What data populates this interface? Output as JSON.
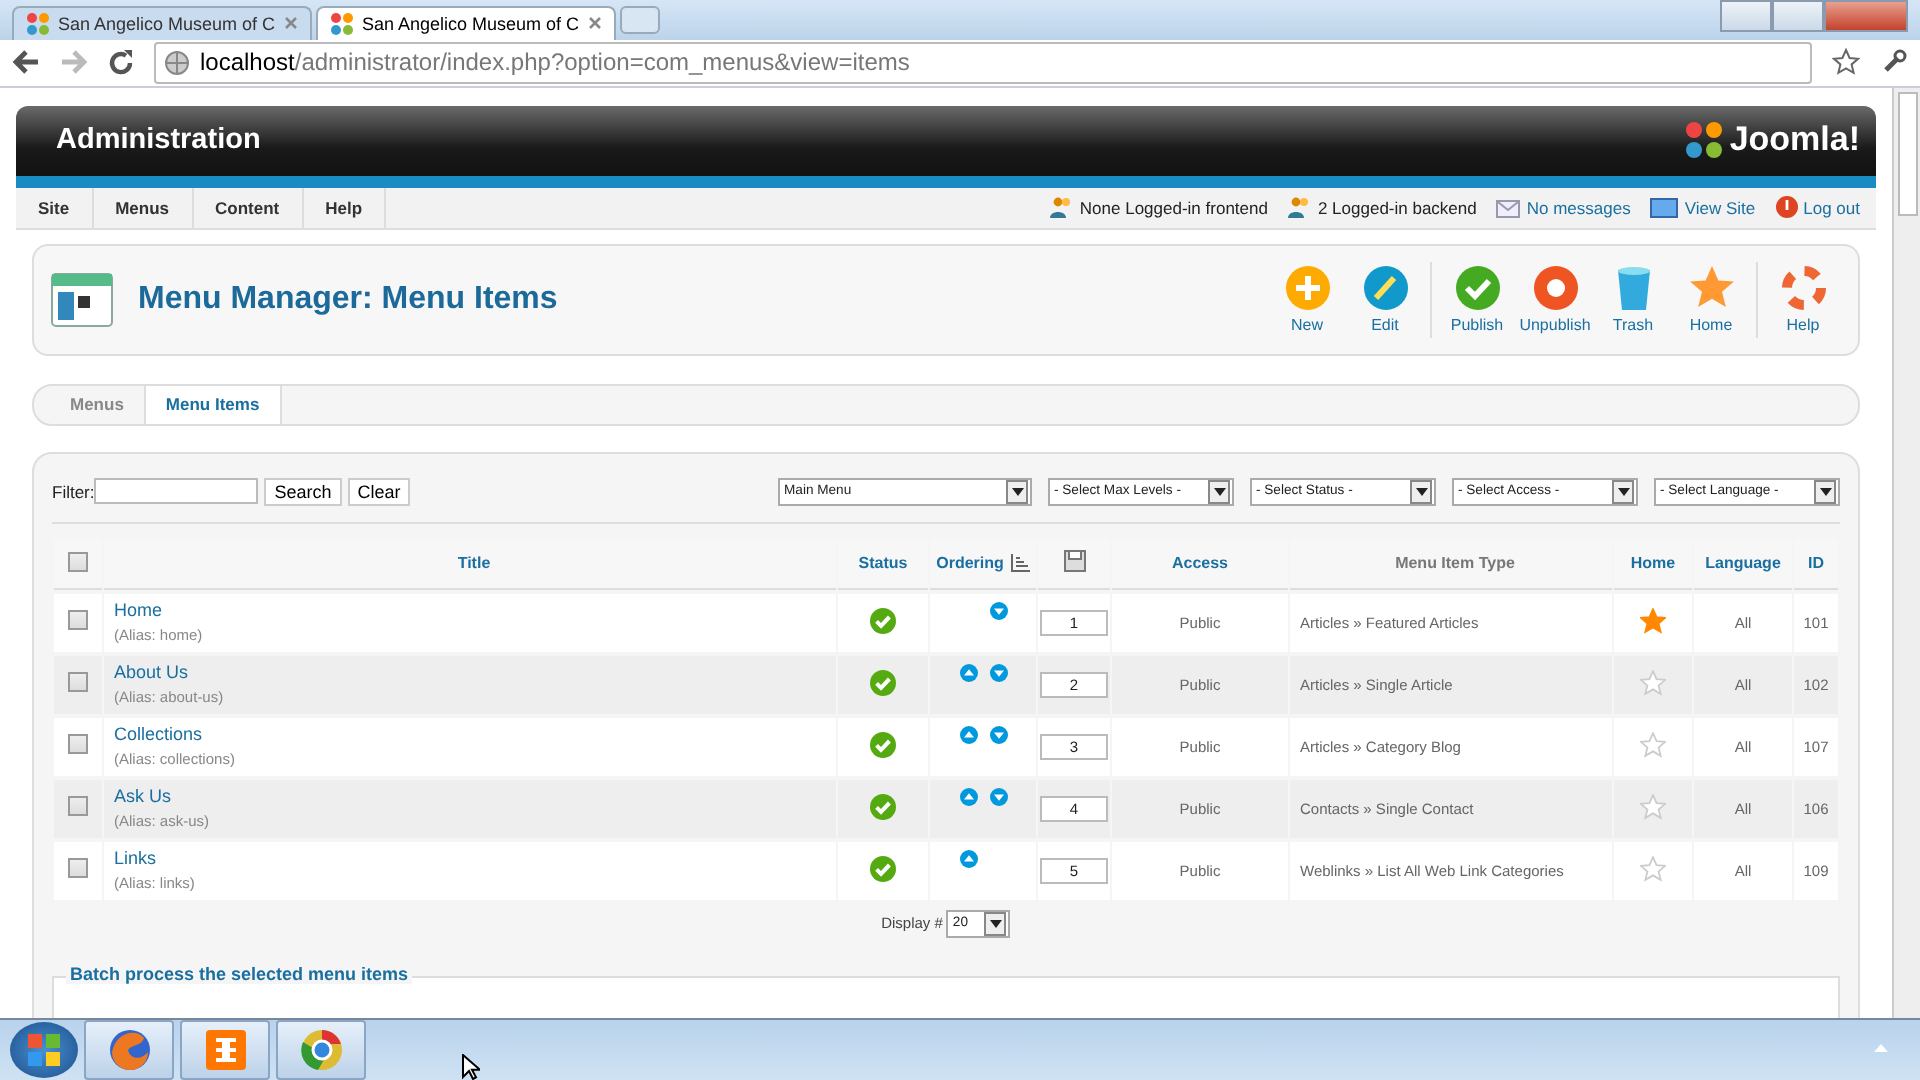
{
  "browser": {
    "tabs": [
      {
        "title": "San Angelico Museum of C",
        "selected": false
      },
      {
        "title": "San Angelico Museum of C",
        "selected": true
      }
    ],
    "url_host": "localhost",
    "url_path": "/administrator/index.php?option=com_menus&view=items"
  },
  "header": {
    "title": "Administration",
    "logo": "Joomla!"
  },
  "menubar": {
    "items": [
      "Site",
      "Menus",
      "Content",
      "Help"
    ],
    "status": [
      {
        "kind": "users",
        "text": "None Logged-in frontend"
      },
      {
        "kind": "users",
        "text": "2 Logged-in backend"
      },
      {
        "kind": "messages",
        "text": "No messages"
      },
      {
        "kind": "viewsite",
        "text": "View Site"
      },
      {
        "kind": "logout",
        "text": "Log out"
      }
    ]
  },
  "toolbar": {
    "title": "Menu Manager: Menu Items",
    "buttons": [
      {
        "kind": "new",
        "label": "New"
      },
      {
        "kind": "edit",
        "label": "Edit"
      },
      {
        "kind": "publish",
        "label": "Publish"
      },
      {
        "kind": "unpublish",
        "label": "Unpublish"
      },
      {
        "kind": "trash",
        "label": "Trash"
      },
      {
        "kind": "home",
        "label": "Home"
      },
      {
        "kind": "help",
        "label": "Help"
      }
    ]
  },
  "submenu": [
    {
      "label": "Menus",
      "selected": false
    },
    {
      "label": "Menu Items",
      "selected": true
    }
  ],
  "filter": {
    "label": "Filter:",
    "search_button": "Search",
    "clear_button": "Clear",
    "selects": [
      "Main Menu",
      "- Select Max Levels -",
      "- Select Status -",
      "- Select Access -",
      "- Select Language -"
    ]
  },
  "table": {
    "all_checked": false,
    "columns": [
      "Title",
      "Status",
      "Ordering",
      "Access",
      "Menu Item Type",
      "Home",
      "Language",
      "ID"
    ],
    "rows": [
      {
        "checked": false,
        "title": "Home",
        "alias": "(Alias: home)",
        "published": true,
        "move_up": false,
        "move_down": true,
        "ordering": "1",
        "access": "Public",
        "type": "Articles » Featured Articles",
        "home": true,
        "language": "All",
        "id": "101"
      },
      {
        "checked": false,
        "title": "About Us",
        "alias": "(Alias: about-us)",
        "published": true,
        "move_up": true,
        "move_down": true,
        "ordering": "2",
        "access": "Public",
        "type": "Articles » Single Article",
        "home": false,
        "language": "All",
        "id": "102"
      },
      {
        "checked": false,
        "title": "Collections",
        "alias": "(Alias: collections)",
        "published": true,
        "move_up": true,
        "move_down": true,
        "ordering": "3",
        "access": "Public",
        "type": "Articles » Category Blog",
        "home": false,
        "language": "All",
        "id": "107"
      },
      {
        "checked": false,
        "title": "Ask Us",
        "alias": "(Alias: ask-us)",
        "published": true,
        "move_up": true,
        "move_down": true,
        "ordering": "4",
        "access": "Public",
        "type": "Contacts » Single Contact",
        "home": false,
        "language": "All",
        "id": "106"
      },
      {
        "checked": false,
        "title": "Links",
        "alias": "(Alias: links)",
        "published": true,
        "move_up": true,
        "move_down": false,
        "ordering": "5",
        "access": "Public",
        "type": "Weblinks » List All Web Link Categories",
        "home": false,
        "language": "All",
        "id": "109"
      }
    ]
  },
  "pagination": {
    "label": "Display #",
    "value": "20"
  },
  "batch": {
    "legend": "Batch process the selected menu items"
  }
}
